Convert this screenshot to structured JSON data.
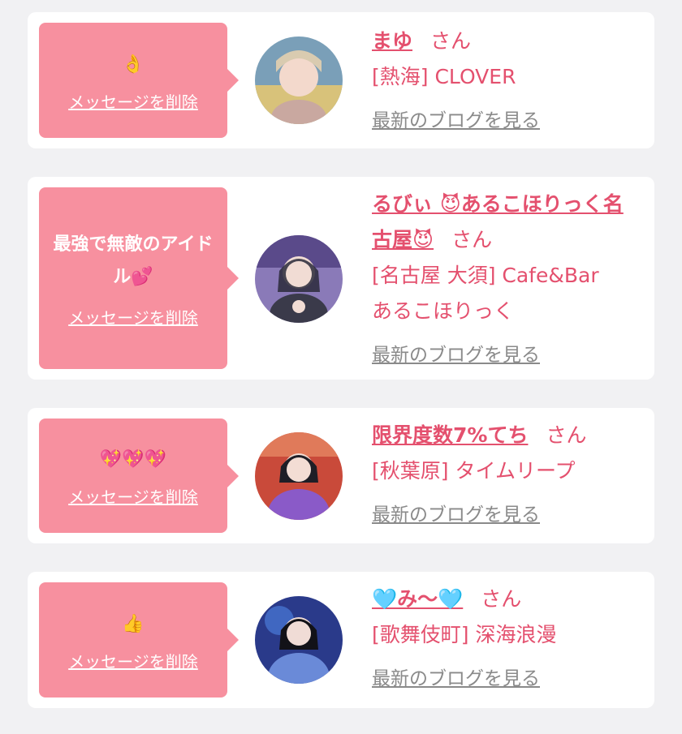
{
  "delete_label": "メッセージを削除",
  "blog_label": "最新のブログを見る",
  "honorific": "さん",
  "colors": {
    "bubble": "#f7909f",
    "name": "#e4506e",
    "link_gray": "#8a8a8a",
    "background": "#f1f1f3"
  },
  "cards": [
    {
      "message": "👌",
      "name": "まゆ",
      "shop_line1": "[熱海] CLOVER",
      "shop_line2": "",
      "avatar_icon": "avatar-photo"
    },
    {
      "message": "最強で無敵のアイドル💕",
      "name": "るびぃ 😈あるこほりっく名古屋😈",
      "shop_line1": "[名古屋 大須] Cafe&Bar",
      "shop_line2": "あるこほりっく",
      "avatar_icon": "avatar-photo"
    },
    {
      "message": "💖💖💖",
      "name": "限界度数7%てち",
      "shop_line1": "[秋葉原] タイムリープ",
      "shop_line2": "",
      "avatar_icon": "avatar-photo"
    },
    {
      "message": "👍",
      "name": "🩵み〜🩵",
      "shop_line1": "[歌舞伎町] 深海浪漫",
      "shop_line2": "",
      "avatar_icon": "avatar-photo"
    }
  ]
}
